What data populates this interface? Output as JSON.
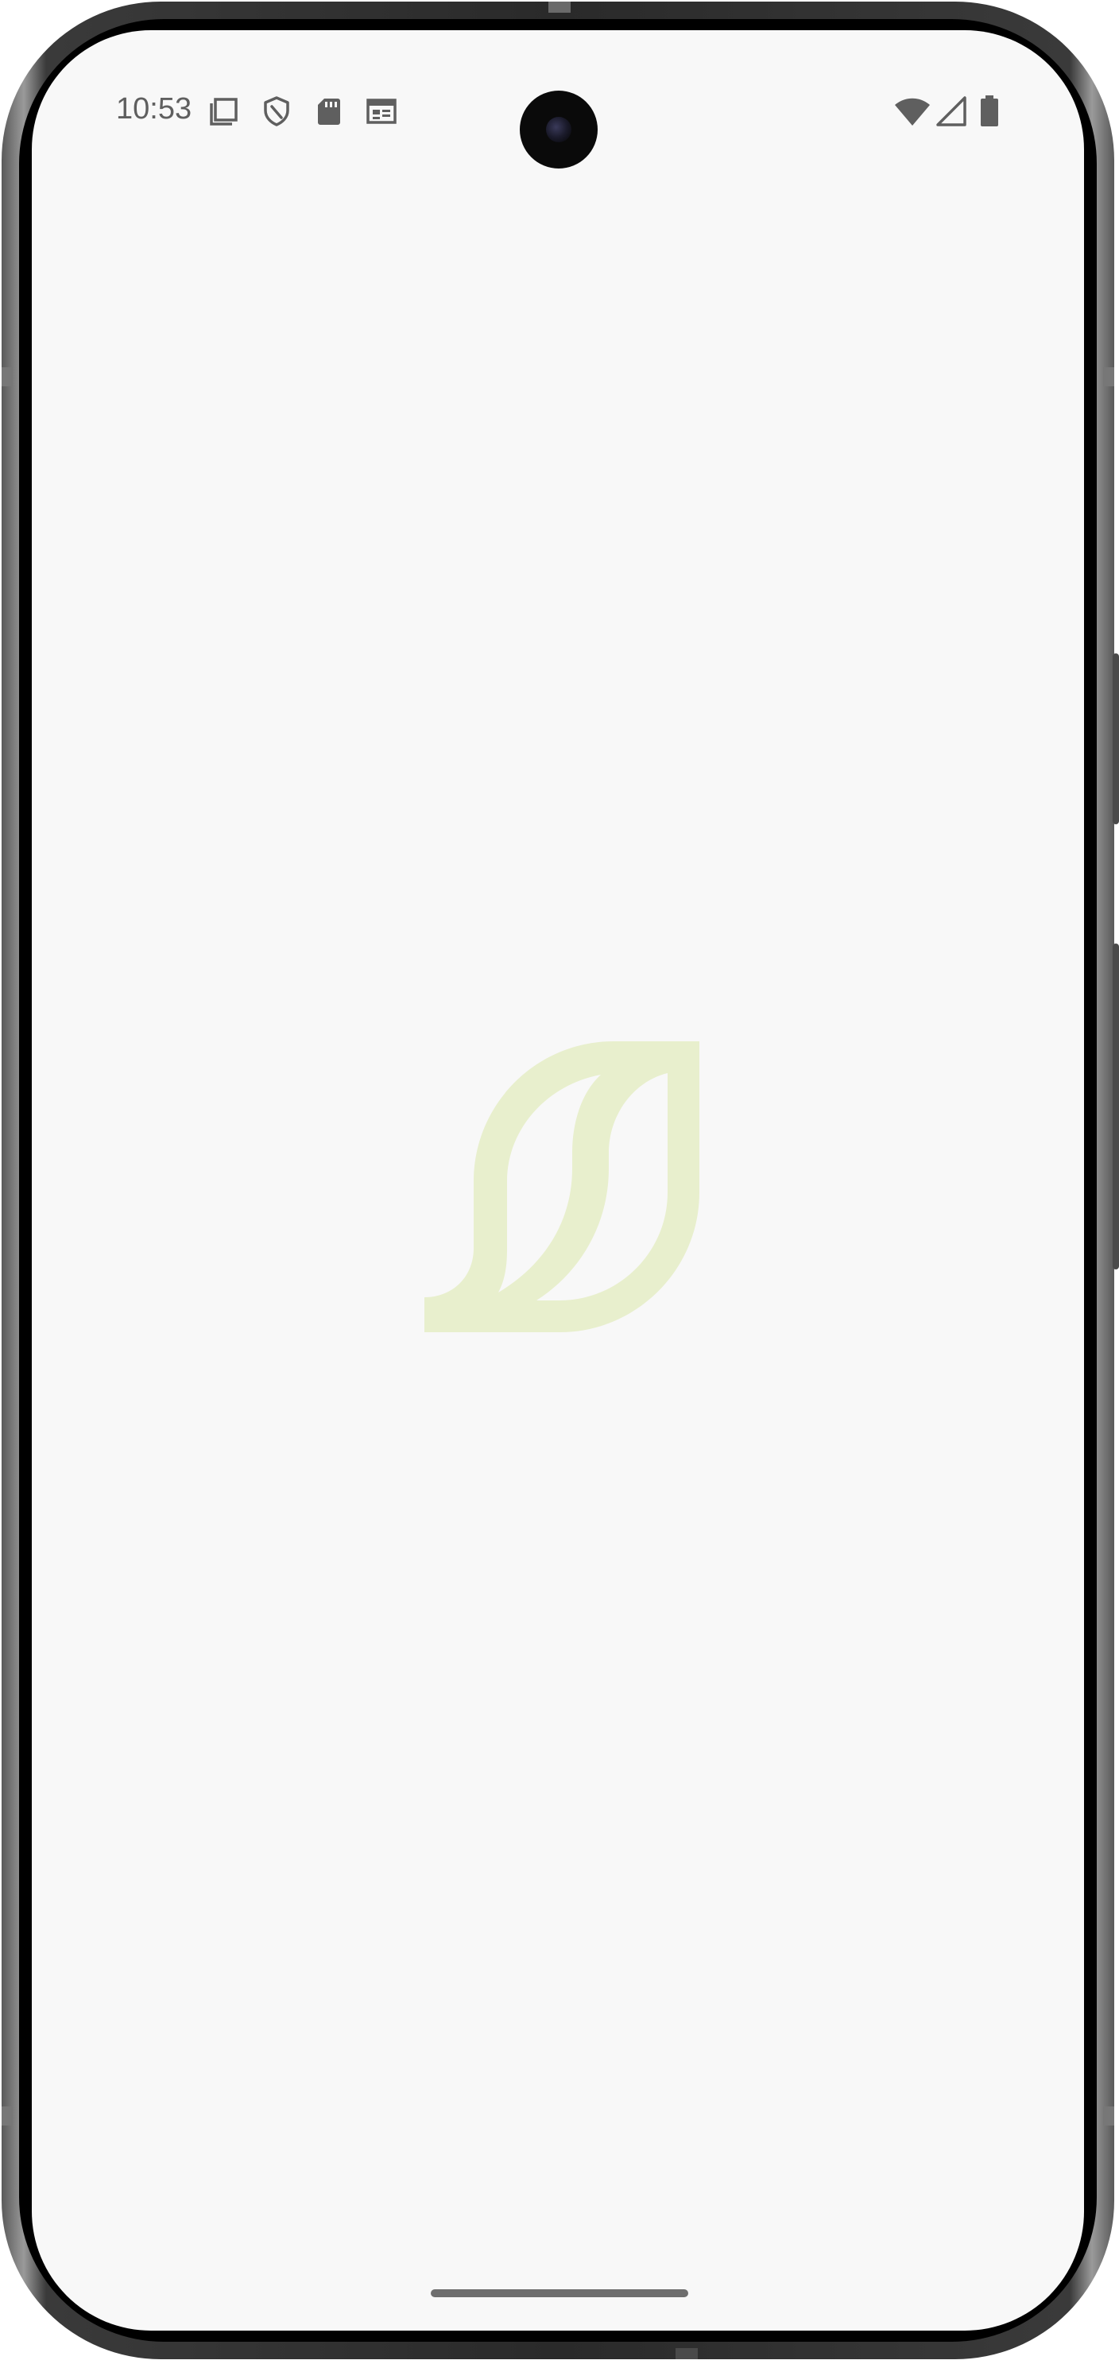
{
  "status_bar": {
    "time": "10:53",
    "left_icons": [
      "screenshot-icon",
      "vpn-shield-icon",
      "sd-card-icon",
      "calendar-icon"
    ],
    "right_icons": [
      "wifi-icon",
      "cell-signal-icon",
      "battery-icon"
    ]
  },
  "splash": {
    "logo_icon": "leaf-logo-icon",
    "logo_color": "#e8efcd"
  },
  "colors": {
    "screen_background": "#f8f8f8",
    "status_icon_color": "#5f5f5f"
  }
}
